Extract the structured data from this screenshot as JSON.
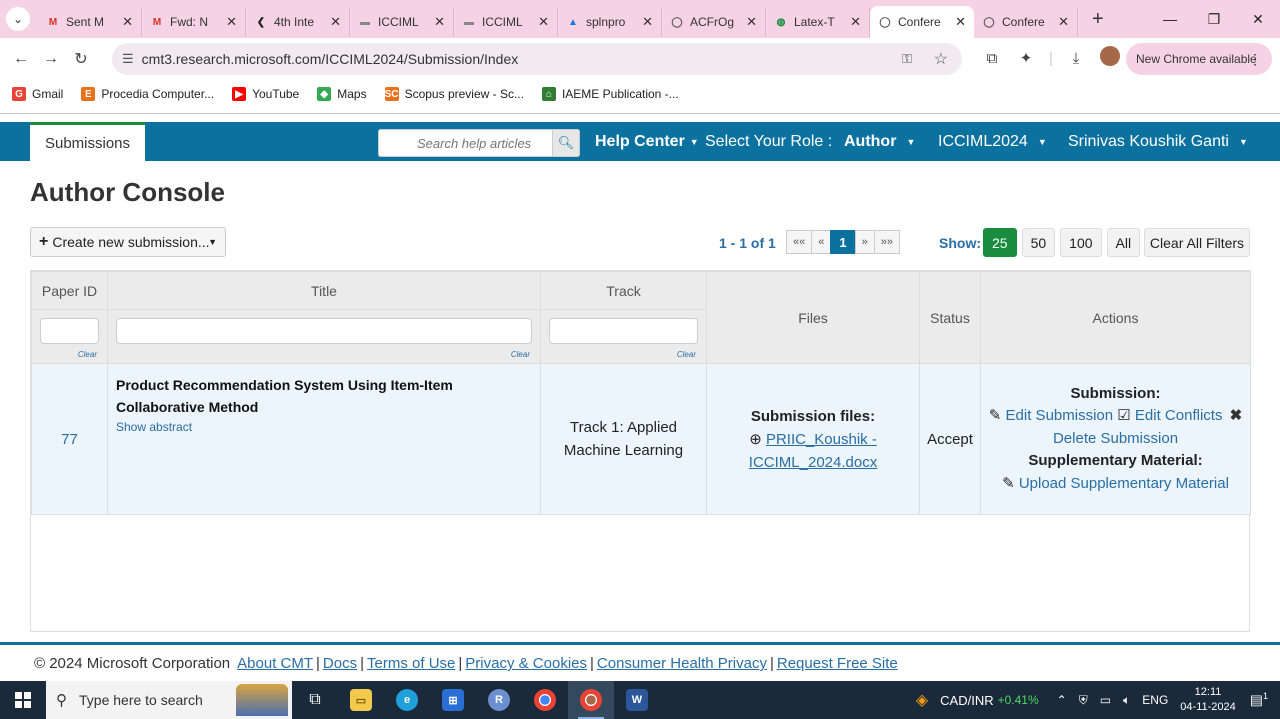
{
  "browser": {
    "tabs": [
      {
        "label": "Sent M",
        "favicon": "gmail-icon",
        "color": "#d93025"
      },
      {
        "label": "Fwd: N",
        "favicon": "gmail-icon",
        "color": "#d93025"
      },
      {
        "label": "4th Inte",
        "favicon": "back-arrow-icon",
        "color": "#222222"
      },
      {
        "label": "ICCIML",
        "favicon": "page-icon",
        "color": "#888888"
      },
      {
        "label": "ICCIML",
        "favicon": "page-icon",
        "color": "#888888"
      },
      {
        "label": "splnpro",
        "favicon": "drive-icon",
        "color": "#1a73e8"
      },
      {
        "label": "ACFrOg",
        "favicon": "globe-icon",
        "color": "#555555"
      },
      {
        "label": "Latex-T",
        "favicon": "overleaf-icon",
        "color": "#138a36"
      },
      {
        "label": "Confere",
        "favicon": "globe-icon",
        "color": "#555555",
        "active": true
      },
      {
        "label": "Confere",
        "favicon": "globe-icon",
        "color": "#555555"
      }
    ],
    "url": "cmt3.research.microsoft.com/ICCIML2024/Submission/Index",
    "new_chrome": "New Chrome available",
    "bookmarks": [
      {
        "label": "Gmail",
        "icon": "G",
        "color": "#ea4335"
      },
      {
        "label": "Procedia Computer...",
        "icon": "E",
        "color": "#e9711c"
      },
      {
        "label": "YouTube",
        "icon": "▶",
        "color": "#ff0000"
      },
      {
        "label": "Maps",
        "icon": "◆",
        "color": "#34a853"
      },
      {
        "label": "Scopus preview - Sc...",
        "icon": "SC",
        "color": "#e9711c"
      },
      {
        "label": "IAEME Publication -...",
        "icon": "⌂",
        "color": "#2e7d32"
      }
    ]
  },
  "nav": {
    "submissions_tab": "Submissions",
    "search_placeholder": "Search help articles",
    "help_center": "Help Center",
    "select_role": "Select Your Role :",
    "role": "Author",
    "conference": "ICCIML2024",
    "user": "Srinivas Koushik Ganti"
  },
  "console": {
    "title": "Author Console",
    "create_btn": "Create new submission...",
    "pager_info": "1 - 1 of 1",
    "pager": [
      "««",
      "«",
      "1",
      "»",
      "»»"
    ],
    "show_label": "Show:",
    "show_options": [
      "25",
      "50",
      "100",
      "All"
    ],
    "clear_all": "Clear All Filters"
  },
  "table": {
    "headers": {
      "paper_id": "Paper ID",
      "title": "Title",
      "track": "Track",
      "files": "Files",
      "status": "Status",
      "actions": "Actions"
    },
    "clear_label": "Clear",
    "row": {
      "paper_id": "77",
      "title": "Product Recommendation System Using Item-Item Collaborative Method",
      "show_abstract": "Show abstract",
      "track": "Track 1: Applied Machine Learning",
      "files_label": "Submission files:",
      "file_name": "PRIIC_Koushik - ICCIML_2024.docx",
      "status": "Accept",
      "actions": {
        "submission_label": "Submission:",
        "edit_submission": "Edit Submission",
        "edit_conflicts": "Edit Conflicts",
        "delete_submission": "Delete Submission",
        "supplementary_label": "Supplementary Material:",
        "upload_supplementary": "Upload Supplementary Material"
      }
    }
  },
  "footer": {
    "copyright": "© 2024 Microsoft Corporation",
    "links": [
      "About CMT",
      "Docs",
      "Terms of Use",
      "Privacy & Cookies",
      "Consumer Health Privacy",
      "Request Free Site"
    ]
  },
  "taskbar": {
    "search_placeholder": "Type here to search",
    "currency": "CAD/INR",
    "currency_change": "+0.41%",
    "lang": "ENG",
    "time": "12:11",
    "date": "04-11-2024",
    "notifications": "1"
  },
  "colors": {
    "nav_blue": "#0b72a0",
    "accent_green": "#1a8c3e",
    "link_blue": "#2a6ea6"
  }
}
